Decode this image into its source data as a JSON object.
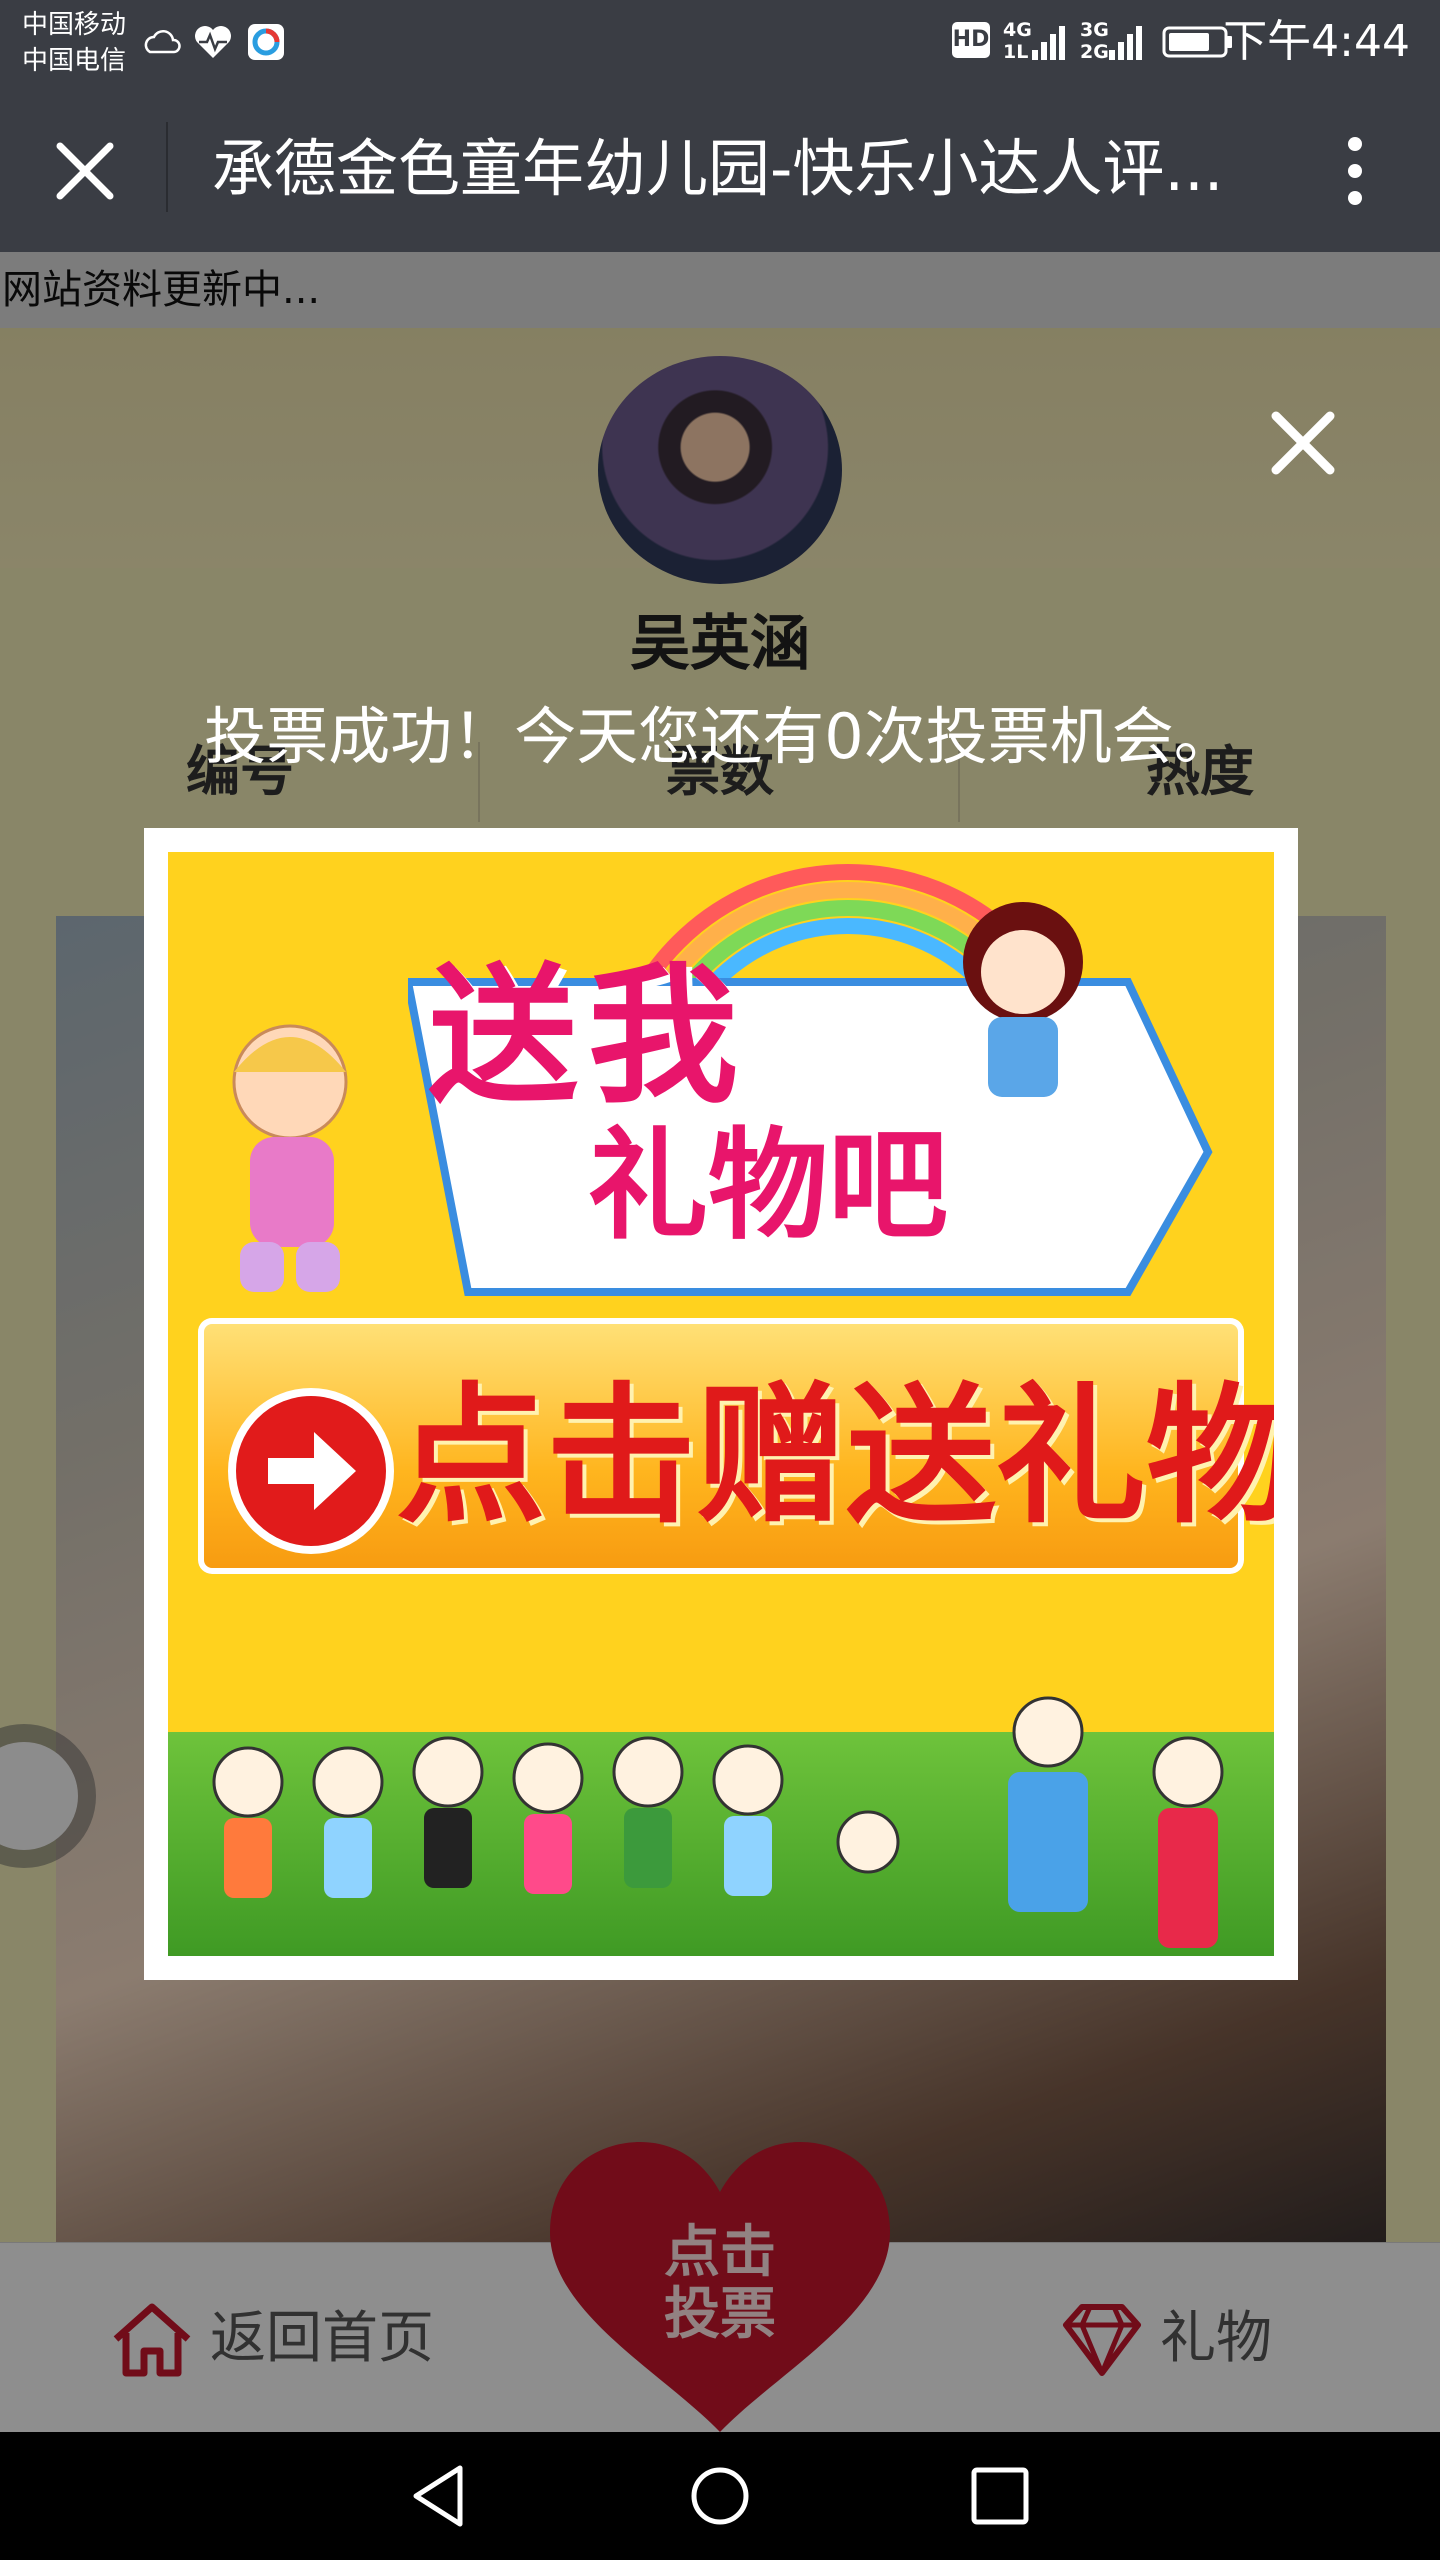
{
  "status_bar": {
    "carrier_1": "中国移动",
    "carrier_2": "中国电信",
    "icons": [
      "weather-icon",
      "health-icon",
      "app-icon",
      "hd-icon",
      "signal-4g-icon",
      "signal-3g-icon",
      "battery-icon"
    ],
    "hd": "HD",
    "net_1_top": "4G",
    "net_1_bottom": "1L",
    "net_2_top": "3G",
    "net_2_bottom": "2G",
    "time": "下午4:44"
  },
  "title_bar": {
    "title": "承德金色童年幼儿园-快乐小达人评...",
    "close_icon": "close-icon",
    "more_icon": "more-vertical-icon"
  },
  "page": {
    "notice": "网站资料更新中...",
    "contestant_name": "吴英涵",
    "stats": [
      "编号",
      "票数",
      "热度"
    ]
  },
  "popup": {
    "message": "投票成功！今天您还有0次投票机会。",
    "banner_title_1": "送我",
    "banner_title_2": "礼物吧",
    "banner_button": "点击赠送礼物"
  },
  "bottom_nav": {
    "home_label": "返回首页",
    "vote_label_line1": "点击",
    "vote_label_line2": "投票",
    "gift_label": "礼物"
  },
  "colors": {
    "title_bar": "#3a3d44",
    "accent_red": "#c3152c",
    "banner_pink": "#e8156b",
    "banner_yellow": "#ffd21e"
  }
}
